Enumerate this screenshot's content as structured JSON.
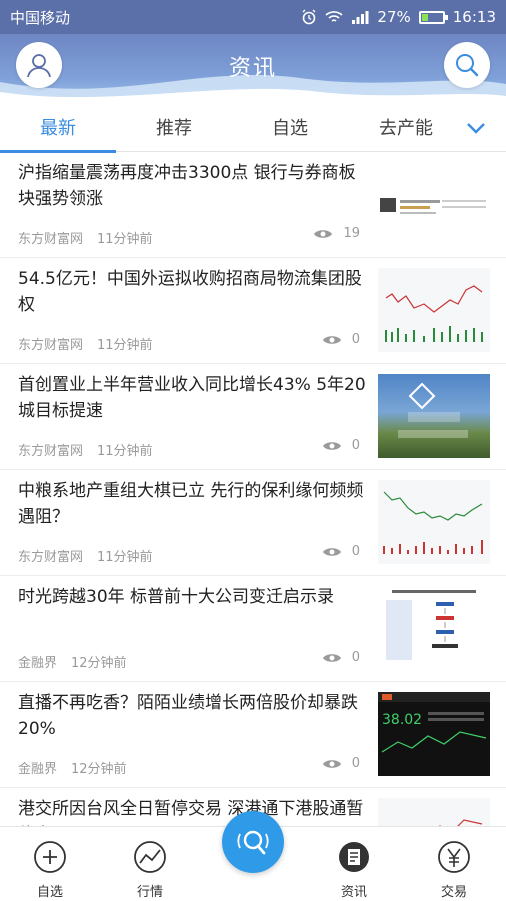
{
  "status": {
    "carrier": "中国移动",
    "battery": "27%",
    "time": "16:13"
  },
  "header": {
    "title": "资讯"
  },
  "tabs": [
    "最新",
    "推荐",
    "自选",
    "去产能"
  ],
  "news": [
    {
      "headline": "沪指缩量震荡再度冲击3300点 银行与券商板块强势领涨",
      "source": "东方财富网",
      "time": "11分钟前",
      "views": "19",
      "thumb": "text"
    },
    {
      "headline": "54.5亿元！中国外运拟收购招商局物流集团股权",
      "source": "东方财富网",
      "time": "11分钟前",
      "views": "0",
      "thumb": "chart-up"
    },
    {
      "headline": "首创置业上半年营业收入同比增长43% 5年20城目标提速",
      "source": "东方财富网",
      "time": "11分钟前",
      "views": "0",
      "thumb": "photo"
    },
    {
      "headline": "中粮系地产重组大棋已立 先行的保利缘何频频遇阻？",
      "source": "东方财富网",
      "time": "11分钟前",
      "views": "0",
      "thumb": "chart-down"
    },
    {
      "headline": "时光跨越30年 标普前十大公司变迁启示录",
      "source": "金融界",
      "time": "12分钟前",
      "views": "0",
      "thumb": "diagram"
    },
    {
      "headline": "直播不再吃香？陌陌业绩增长两倍股价却暴跌20%",
      "source": "金融界",
      "time": "12分钟前",
      "views": "0",
      "thumb": "quote"
    },
    {
      "headline": "港交所因台风全日暂停交易 深港通下港股通暂停交易",
      "source": "",
      "time": "",
      "views": "",
      "thumb": "chart-up"
    }
  ],
  "thumb_text": {
    "quote_price": "38.02"
  },
  "bottom_nav": [
    "自选",
    "行情",
    "资讯",
    "交易"
  ]
}
